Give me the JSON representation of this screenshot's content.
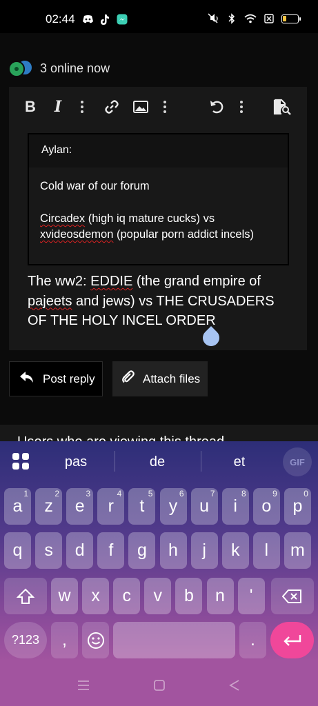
{
  "status_bar": {
    "time": "02:44",
    "app_icons": [
      "discord-icon",
      "tiktok-icon",
      "messenger-icon"
    ],
    "right_icons": [
      "mute-vibrate-icon",
      "bluetooth-icon",
      "wifi-icon",
      "sim-off-icon",
      "battery-icon"
    ],
    "battery_level": 0.22
  },
  "online": {
    "text": "3 online now"
  },
  "editor": {
    "toolbar": [
      "bold",
      "italic",
      "more",
      "link",
      "image",
      "more",
      "undo",
      "more",
      "preview"
    ],
    "quote": {
      "author": "Aylan:",
      "line1": "Cold war of our forum",
      "line2_word1": "Circadex",
      "line2_rest": " (high iq mature cucks) vs ",
      "line2_word2": "xvideosdemon",
      "line2_end": " (popular porn addict incels)"
    },
    "body": {
      "part1": "The ww2: ",
      "word_eddie": "EDDIE",
      "part2": " (the grand empire of ",
      "word_pajeets": "pajeets",
      "part3": " and jews) vs THE CRUSADERS OF THE HOLY INCEL ORDER"
    }
  },
  "actions": {
    "post_reply": "Post reply",
    "attach_files": "Attach files"
  },
  "below_text": "Users who are viewing this thread",
  "keyboard": {
    "suggestions": [
      "pas",
      "de",
      "et"
    ],
    "gif_label": "GIF",
    "row1": [
      {
        "k": "a",
        "h": "1"
      },
      {
        "k": "z",
        "h": "2"
      },
      {
        "k": "e",
        "h": "3"
      },
      {
        "k": "r",
        "h": "4"
      },
      {
        "k": "t",
        "h": "5"
      },
      {
        "k": "y",
        "h": "6"
      },
      {
        "k": "u",
        "h": "7"
      },
      {
        "k": "i",
        "h": "8"
      },
      {
        "k": "o",
        "h": "9"
      },
      {
        "k": "p",
        "h": "0"
      }
    ],
    "row2": [
      "q",
      "s",
      "d",
      "f",
      "g",
      "h",
      "j",
      "k",
      "l",
      "m"
    ],
    "row3": [
      "w",
      "x",
      "c",
      "v",
      "b",
      "n",
      "'"
    ],
    "sym_label": "?123",
    "comma": ",",
    "period": "."
  }
}
